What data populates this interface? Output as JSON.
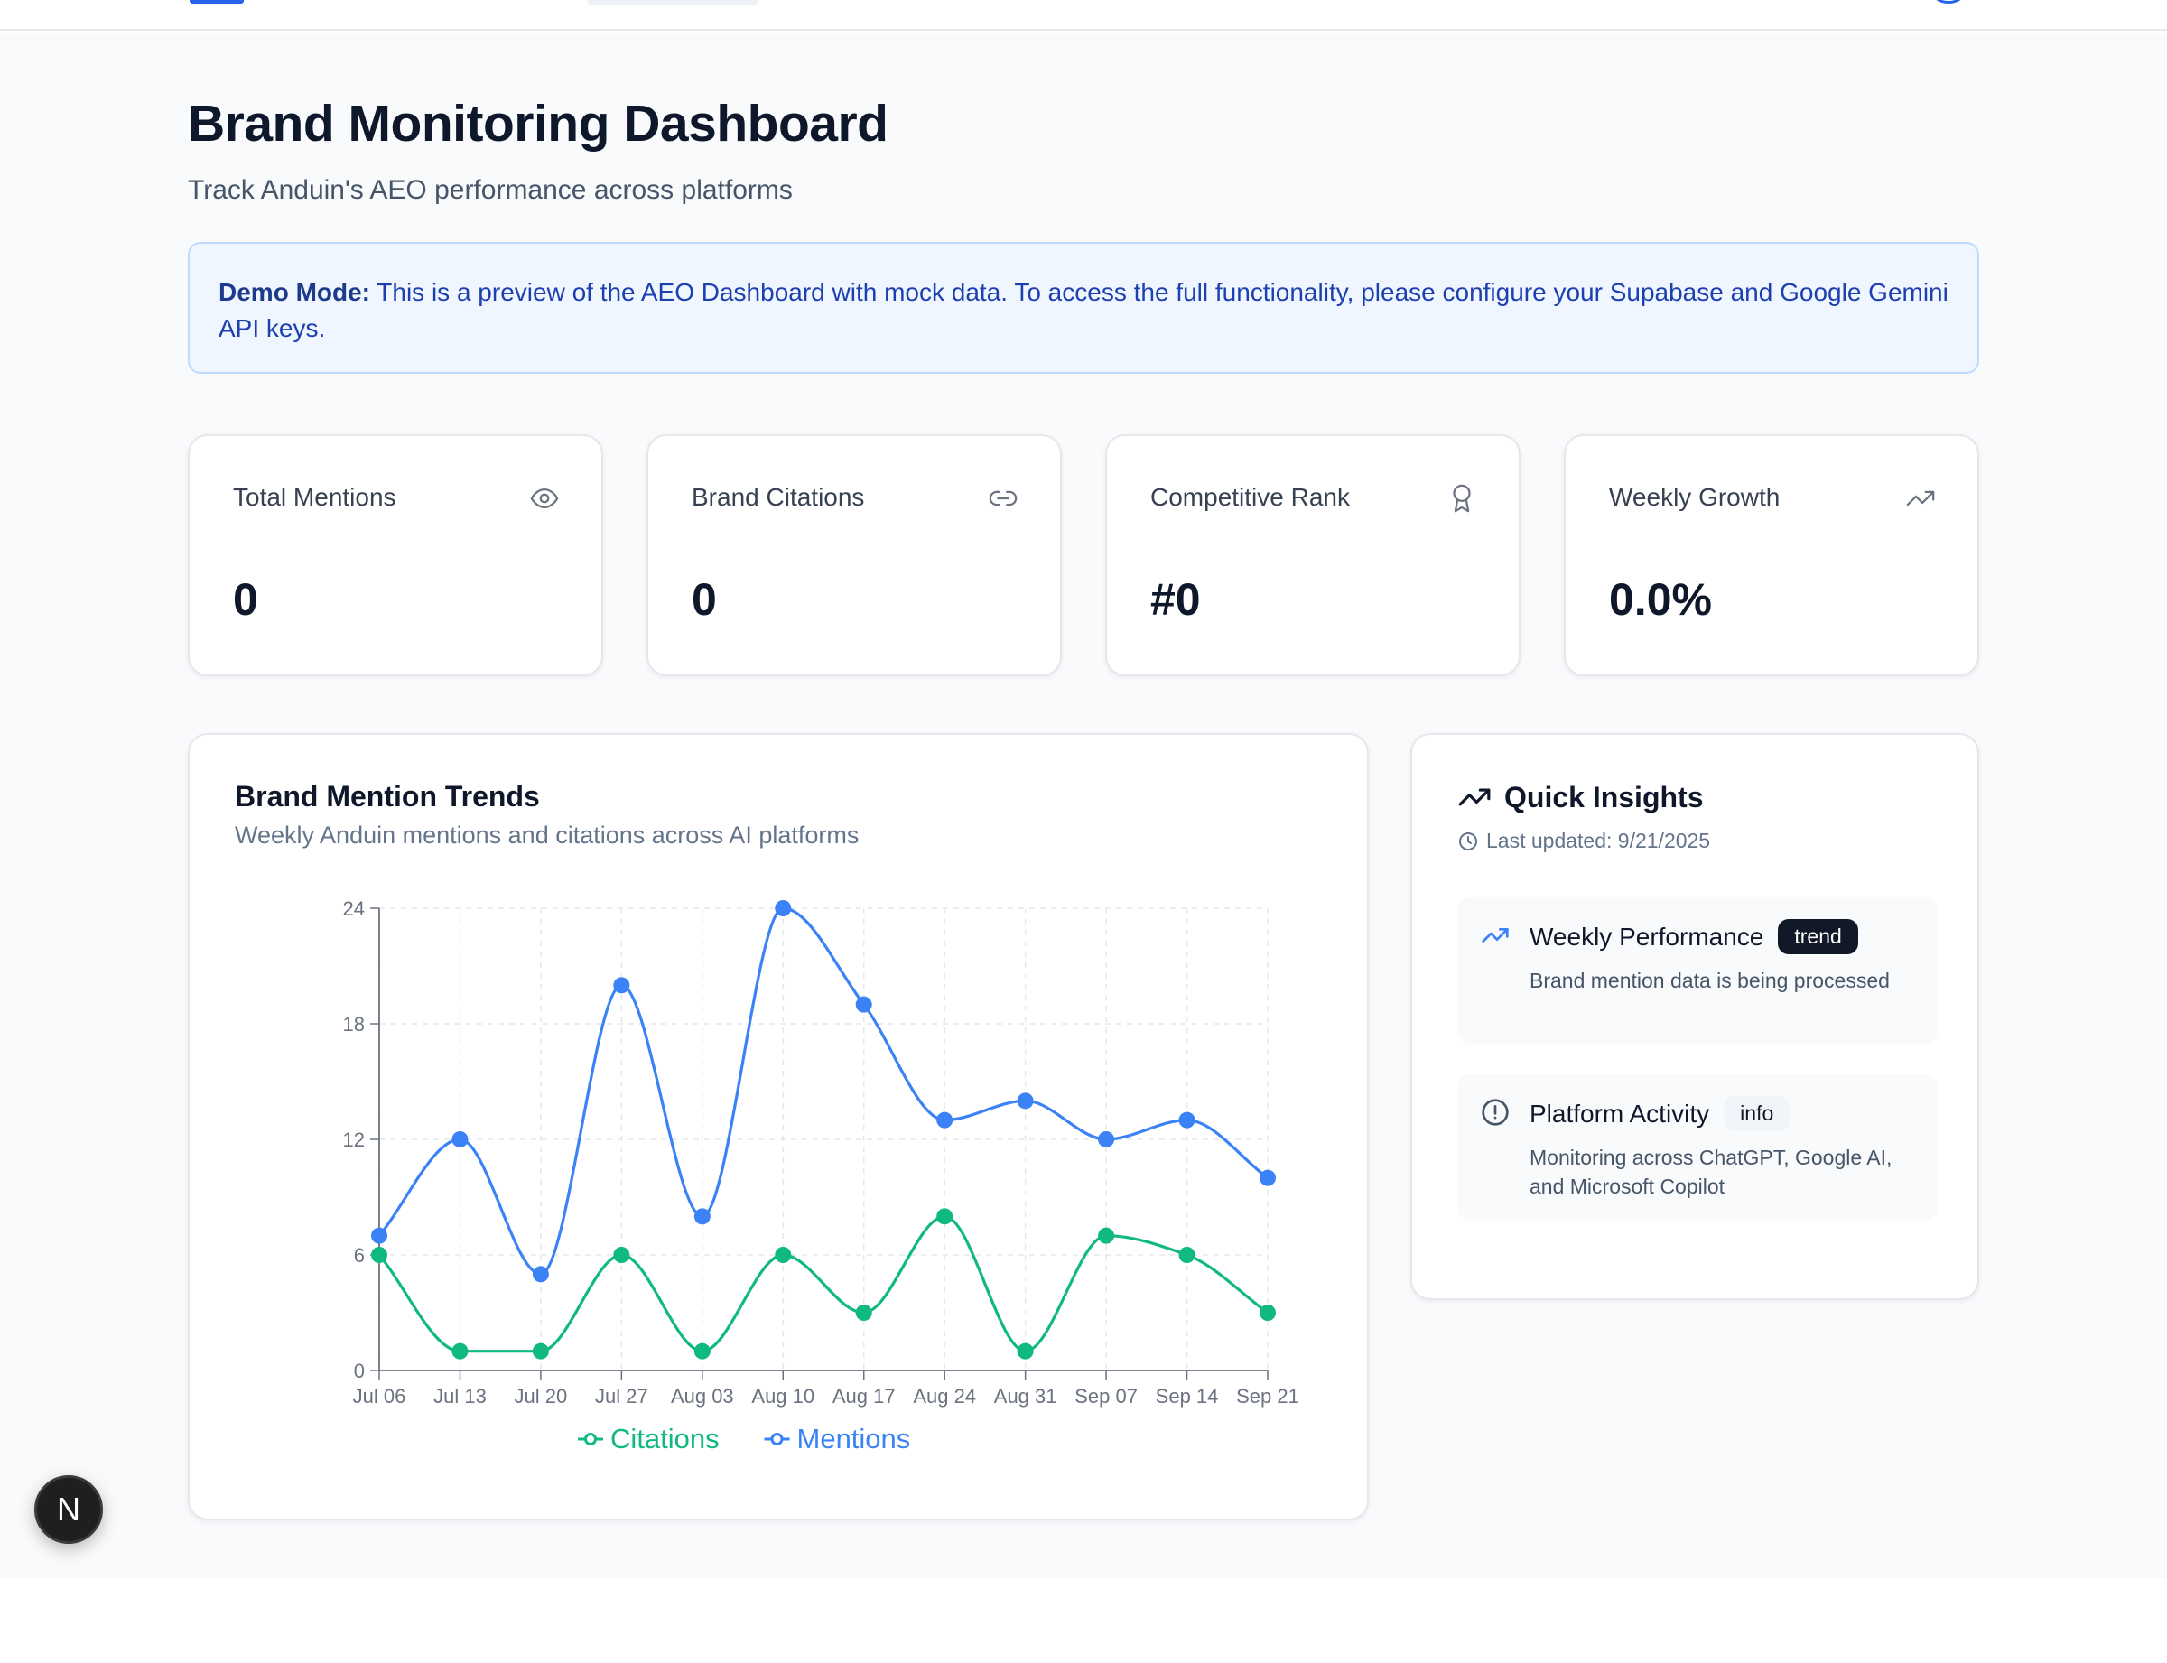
{
  "header": {
    "title": "Brand Monitoring Dashboard",
    "subtitle": "Track Anduin's AEO performance across platforms"
  },
  "banner": {
    "label": "Demo Mode:",
    "text": " This is a preview of the AEO Dashboard with mock data. To access the full functionality, please configure your Supabase and Google Gemini API keys."
  },
  "stats": [
    {
      "label": "Total Mentions",
      "value": "0",
      "icon": "eye-icon"
    },
    {
      "label": "Brand Citations",
      "value": "0",
      "icon": "link-icon"
    },
    {
      "label": "Competitive Rank",
      "value": "#0",
      "icon": "award-icon"
    },
    {
      "label": "Weekly Growth",
      "value": "0.0%",
      "icon": "trending-up-icon"
    }
  ],
  "chart": {
    "title": "Brand Mention Trends",
    "subtitle": "Weekly Anduin mentions and citations across AI platforms"
  },
  "chart_data": {
    "type": "line",
    "x": [
      "Jul 06",
      "Jul 13",
      "Jul 20",
      "Jul 27",
      "Aug 03",
      "Aug 10",
      "Aug 17",
      "Aug 24",
      "Aug 31",
      "Sep 07",
      "Sep 14",
      "Sep 21"
    ],
    "series": [
      {
        "name": "Mentions",
        "color": "#3b82f6",
        "values": [
          7,
          12,
          5,
          20,
          8,
          24,
          19,
          13,
          14,
          12,
          13,
          10
        ]
      },
      {
        "name": "Citations",
        "color": "#10b981",
        "values": [
          6,
          1,
          1,
          6,
          1,
          6,
          3,
          8,
          1,
          7,
          6,
          3
        ]
      }
    ],
    "yticks": [
      0,
      6,
      12,
      18,
      24
    ],
    "ylim": [
      0,
      24
    ],
    "grid": true,
    "legend_position": "bottom-center",
    "legend_order": [
      "Citations",
      "Mentions"
    ]
  },
  "insights": {
    "title": "Quick Insights",
    "updated": "Last updated: 9/21/2025",
    "items": [
      {
        "name": "Weekly Performance",
        "badge": "trend",
        "desc": "Brand mention data is being processed",
        "icon": "trending-up-icon"
      },
      {
        "name": "Platform Activity",
        "badge": "info",
        "desc": "Monitoring across ChatGPT, Google AI, and Microsoft Copilot",
        "icon": "alert-circle-icon"
      }
    ]
  },
  "fab": {
    "label": "N"
  },
  "colors": {
    "accent": "#3b82f6",
    "success": "#10b981",
    "banner_bg": "#eff6ff"
  }
}
